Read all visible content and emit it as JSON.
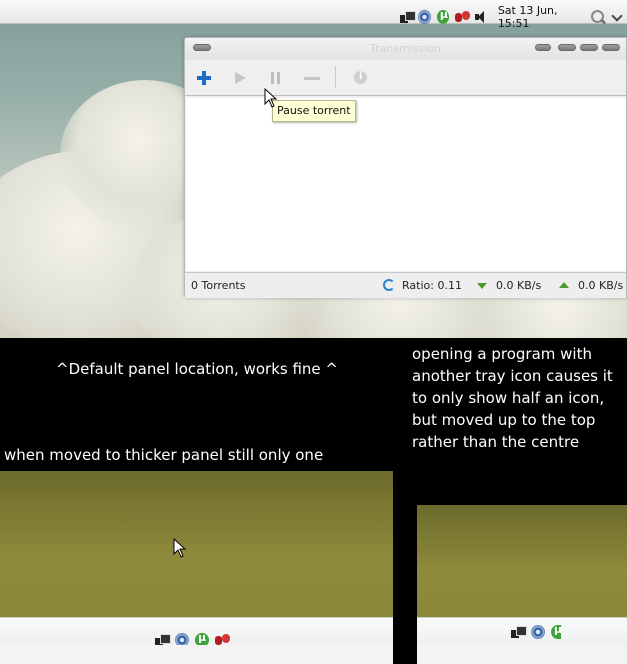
{
  "top_panel": {
    "tray_icons": [
      "network-icon",
      "transmission-icon",
      "utorrent-icon",
      "pidgin-icon",
      "volume-icon"
    ],
    "clock": "Sat 13 Jun, 15:51"
  },
  "window": {
    "title": "Transmission",
    "toolbar": {
      "add": "add-torrent",
      "start": "start-torrent",
      "pause": "pause-torrent",
      "remove": "remove-torrent",
      "info": "torrent-properties"
    },
    "tooltip": "Pause torrent",
    "status": {
      "count": "0 Torrents",
      "ratio": "Ratio: 0.11",
      "down": "0.0 KB/s",
      "up": "0.0 KB/s"
    }
  },
  "captions": {
    "default": "^Default panel location, works fine ^",
    "thicker": "when moved to thicker panel still only one",
    "right_lines": [
      "opening a program with",
      " another tray icon causes it",
      " to only show half an icon,",
      "but moved up to the top",
      "rather than the centre"
    ]
  },
  "colors": {
    "accent_blue": "#1f6cc7",
    "speed_green": "#4d9b2c",
    "tooltip_bg": "#ffffd6"
  }
}
